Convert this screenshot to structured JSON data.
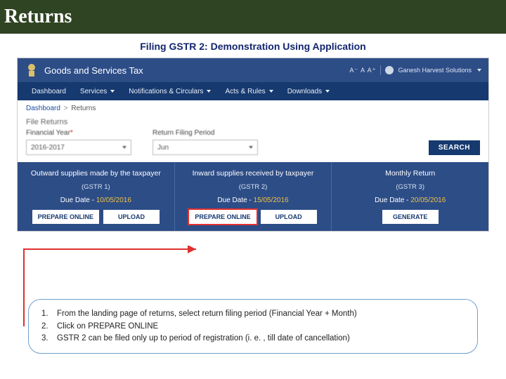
{
  "slide": {
    "title": "Returns",
    "subheading": "Filing GSTR 2: Demonstration Using Application"
  },
  "app": {
    "header": {
      "title": "Goods and Services Tax",
      "font_sizer": "A⁻  A  A⁺",
      "user_label": "Ganesh Harvest Solutions"
    },
    "nav": {
      "dashboard": "Dashboard",
      "services": "Services",
      "notifications": "Notifications & Circulars",
      "acts": "Acts & Rules",
      "downloads": "Downloads"
    },
    "breadcrumb": {
      "root": "Dashboard",
      "sep": ">",
      "current": "Returns"
    },
    "section_title": "File Returns",
    "form": {
      "fy_label": "Financial Year",
      "fy_value": "2016-2017",
      "period_label": "Return Filing Period",
      "period_value": "Jun",
      "search": "SEARCH"
    },
    "cards": [
      {
        "title": "Outward supplies made by the taxpayer",
        "sub": "(GSTR 1)",
        "due_label": "Due Date -",
        "due_date": "10/05/2016",
        "btn1": "PREPARE ONLINE",
        "btn2": "UPLOAD"
      },
      {
        "title": "Inward supplies received by taxpayer",
        "sub": "(GSTR 2)",
        "due_label": "Due Date -",
        "due_date": "15/05/2016",
        "btn1": "PREPARE ONLINE",
        "btn2": "UPLOAD"
      },
      {
        "title": "Monthly Return",
        "sub": "(GSTR 3)",
        "due_label": "Due Date -",
        "due_date": "20/05/2016",
        "btn1": "GENERATE"
      }
    ]
  },
  "notes": {
    "n1": {
      "num": "1.",
      "text": "From the landing page of returns, select return filing period (Financial Year + Month)"
    },
    "n2": {
      "num": "2.",
      "text": "Click on PREPARE ONLINE"
    },
    "n3": {
      "num": "3.",
      "text": "GSTR 2 can be filed only up to period of registration (i. e. , till date of cancellation)"
    }
  }
}
